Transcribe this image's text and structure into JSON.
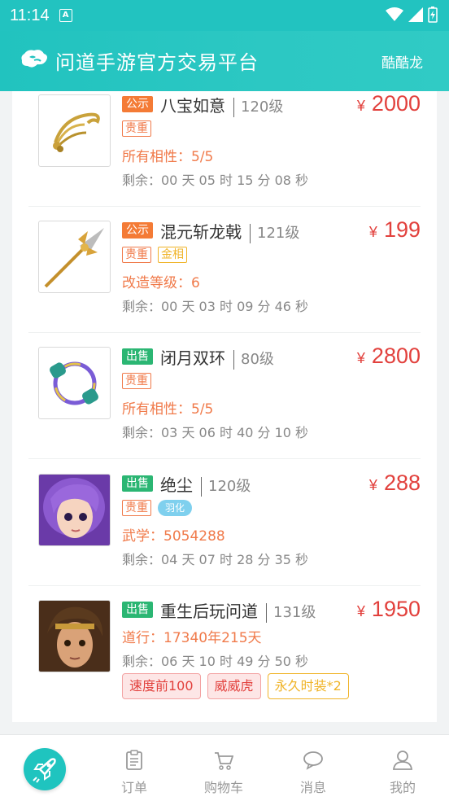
{
  "status_bar": {
    "time": "11:14",
    "notification_icon": "A"
  },
  "header": {
    "title": "问道手游官方交易平台",
    "user": "酷酷龙",
    "logo": "cloud-logo-icon"
  },
  "items": [
    {
      "status_tag": "公示",
      "status_color": "#f47b36",
      "name": "八宝如意",
      "level": "120级",
      "currency": "¥",
      "price": "2000",
      "badges": [
        "贵重"
      ],
      "attr": "所有相性：5/5",
      "remain": "剩余：00 天 05 时 15 分 08 秒",
      "image": "ruyi-scepter-image"
    },
    {
      "status_tag": "公示",
      "status_color": "#f47b36",
      "name": "混元斩龙戟",
      "level": "121级",
      "currency": "¥",
      "price": "199",
      "badges": [
        "贵重",
        "金相"
      ],
      "attr": "改造等级：6",
      "remain": "剩余：00 天 03 时 09 分 46 秒",
      "image": "halberd-image"
    },
    {
      "status_tag": "出售",
      "status_color": "#2bb673",
      "name": "闭月双环",
      "level": "80级",
      "currency": "¥",
      "price": "2800",
      "badges": [
        "贵重"
      ],
      "attr": "所有相性：5/5",
      "remain": "剩余：03 天 06 时 40 分 10 秒",
      "image": "double-ring-image"
    },
    {
      "status_tag": "出售",
      "status_color": "#2bb673",
      "name": "绝尘",
      "level": "120级",
      "currency": "¥",
      "price": "288",
      "badges": [
        "贵重",
        "羽化"
      ],
      "attr": "武学：5054288",
      "remain": "剩余：04 天 07 时 28 分 35 秒",
      "image": "character-avatar-purple-hair"
    },
    {
      "status_tag": "出售",
      "status_color": "#2bb673",
      "name": "重生后玩问道",
      "level": "131级",
      "currency": "¥",
      "price": "1950",
      "attr": "道行：17340年215天",
      "remain": "剩余：06 天 10 时 49 分 50 秒",
      "pills": [
        "速度前100",
        "威威虎",
        "永久时装*2"
      ],
      "image": "character-avatar-warrior"
    }
  ],
  "bottom_nav": {
    "home_icon": "rocket-icon",
    "items": [
      {
        "label": "订单",
        "icon": "clipboard-icon"
      },
      {
        "label": "购物车",
        "icon": "cart-icon"
      },
      {
        "label": "消息",
        "icon": "chat-icon"
      },
      {
        "label": "我的",
        "icon": "user-icon"
      }
    ]
  },
  "colors": {
    "brand": "#22c3c0",
    "price": "#e2413d",
    "attr": "#f07a4a"
  }
}
